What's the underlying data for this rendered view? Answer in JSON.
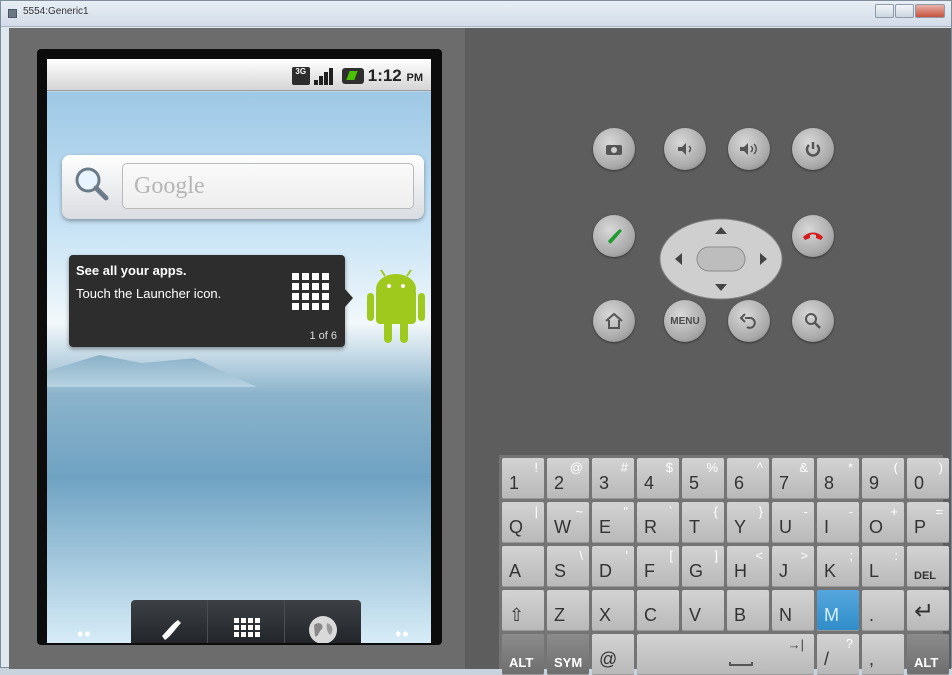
{
  "window": {
    "title": "5554:Generic1"
  },
  "phone": {
    "status": {
      "network": "3G",
      "time": "1:12",
      "ampm": "PM"
    },
    "search": {
      "placeholder": "Google"
    },
    "tip": {
      "title": "See all your apps.",
      "body": "Touch the Launcher icon.",
      "count": "1 of 6"
    },
    "dock": {
      "dots_left": "••",
      "dots_right": "••"
    }
  },
  "controls": {
    "menu_label": "MENU"
  },
  "keyboard": {
    "rows": [
      [
        {
          "main": "1",
          "alt": "!"
        },
        {
          "main": "2",
          "alt": "@"
        },
        {
          "main": "3",
          "alt": "#"
        },
        {
          "main": "4",
          "alt": "$"
        },
        {
          "main": "5",
          "alt": "%"
        },
        {
          "main": "6",
          "alt": "^"
        },
        {
          "main": "7",
          "alt": "&"
        },
        {
          "main": "8",
          "alt": "*"
        },
        {
          "main": "9",
          "alt": "("
        },
        {
          "main": "0",
          "alt": ")"
        }
      ],
      [
        {
          "main": "Q",
          "alt": "|"
        },
        {
          "main": "W",
          "alt": "~"
        },
        {
          "main": "E",
          "alt": "\""
        },
        {
          "main": "R",
          "alt": "`"
        },
        {
          "main": "T",
          "alt": "{"
        },
        {
          "main": "Y",
          "alt": "}"
        },
        {
          "main": "U",
          "alt": "-"
        },
        {
          "main": "I",
          "alt": "-"
        },
        {
          "main": "O",
          "alt": "+"
        },
        {
          "main": "P",
          "alt": "="
        }
      ],
      [
        {
          "main": "A",
          "alt": ""
        },
        {
          "main": "S",
          "alt": "\\"
        },
        {
          "main": "D",
          "alt": "'"
        },
        {
          "main": "F",
          "alt": "["
        },
        {
          "main": "G",
          "alt": "]"
        },
        {
          "main": "H",
          "alt": "<"
        },
        {
          "main": "J",
          "alt": ">"
        },
        {
          "main": "K",
          "alt": ";"
        },
        {
          "main": "L",
          "alt": ":"
        },
        {
          "main": "DEL",
          "alt": ""
        }
      ],
      [
        {
          "main": "⇧",
          "alt": ""
        },
        {
          "main": "Z",
          "alt": ""
        },
        {
          "main": "X",
          "alt": ""
        },
        {
          "main": "C",
          "alt": ""
        },
        {
          "main": "V",
          "alt": ""
        },
        {
          "main": "B",
          "alt": ""
        },
        {
          "main": "N",
          "alt": ""
        },
        {
          "main": "M",
          "alt": ""
        },
        {
          "main": ".",
          "alt": ""
        },
        {
          "main": "↵",
          "alt": ""
        }
      ],
      [
        {
          "main": "ALT",
          "alt": ""
        },
        {
          "main": "SYM",
          "alt": ""
        },
        {
          "main": "@",
          "alt": ""
        },
        {
          "main": "",
          "alt": "→|"
        },
        {
          "main": "/",
          "alt": "?"
        },
        {
          "main": ",",
          "alt": ""
        },
        {
          "main": "ALT",
          "alt": ""
        }
      ]
    ]
  },
  "colors": {
    "accent_blue": "#2f8cc8",
    "call_green": "#1f9a2d",
    "end_red": "#d51b1b"
  }
}
